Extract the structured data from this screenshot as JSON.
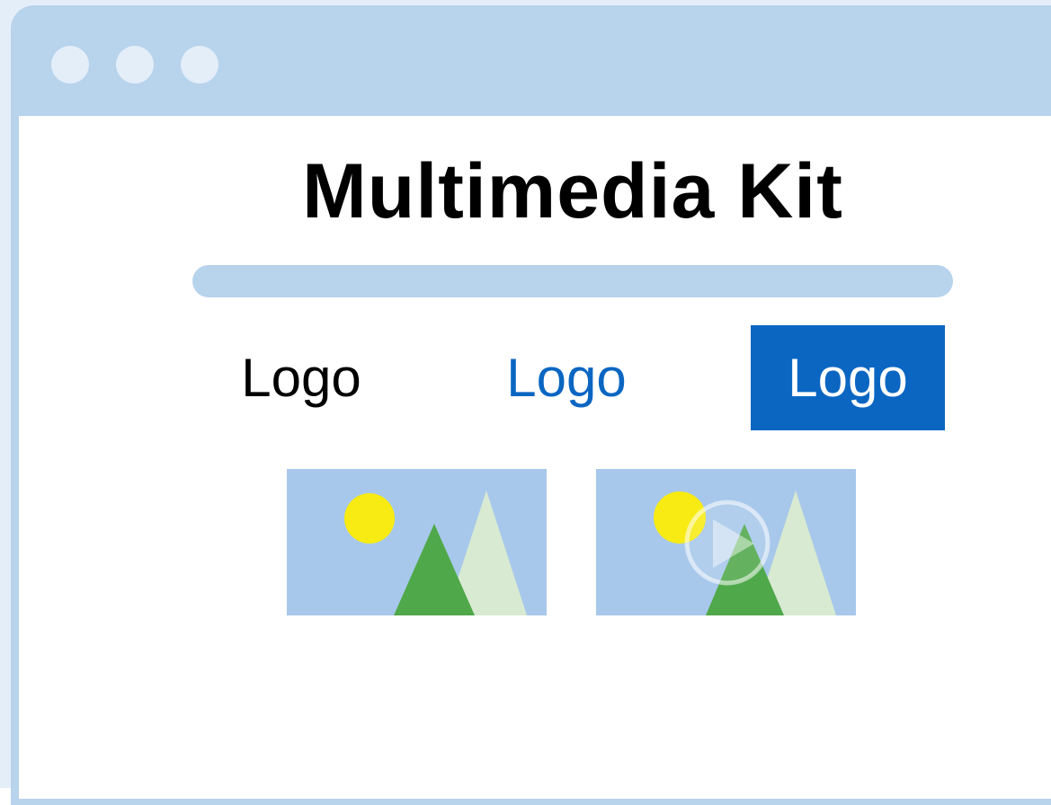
{
  "window": {
    "controls": [
      "window-dot",
      "window-dot",
      "window-dot"
    ]
  },
  "page": {
    "title": "Multimedia Kit"
  },
  "logos": {
    "black_label": "Logo",
    "blue_label": "Logo",
    "filled_label": "Logo"
  },
  "media": {
    "image_icon": "image-thumbnail-icon",
    "video_icon": "video-thumbnail-icon",
    "play_icon": "play-icon"
  },
  "colors": {
    "chrome": "#b8d3ec",
    "background": "#e4eef9",
    "accent_blue": "#0b66c2",
    "sun_yellow": "#f7eb13",
    "tree_green": "#4fa84a",
    "tree_light": "#d8ead1",
    "sky": "#a7c8ea"
  }
}
